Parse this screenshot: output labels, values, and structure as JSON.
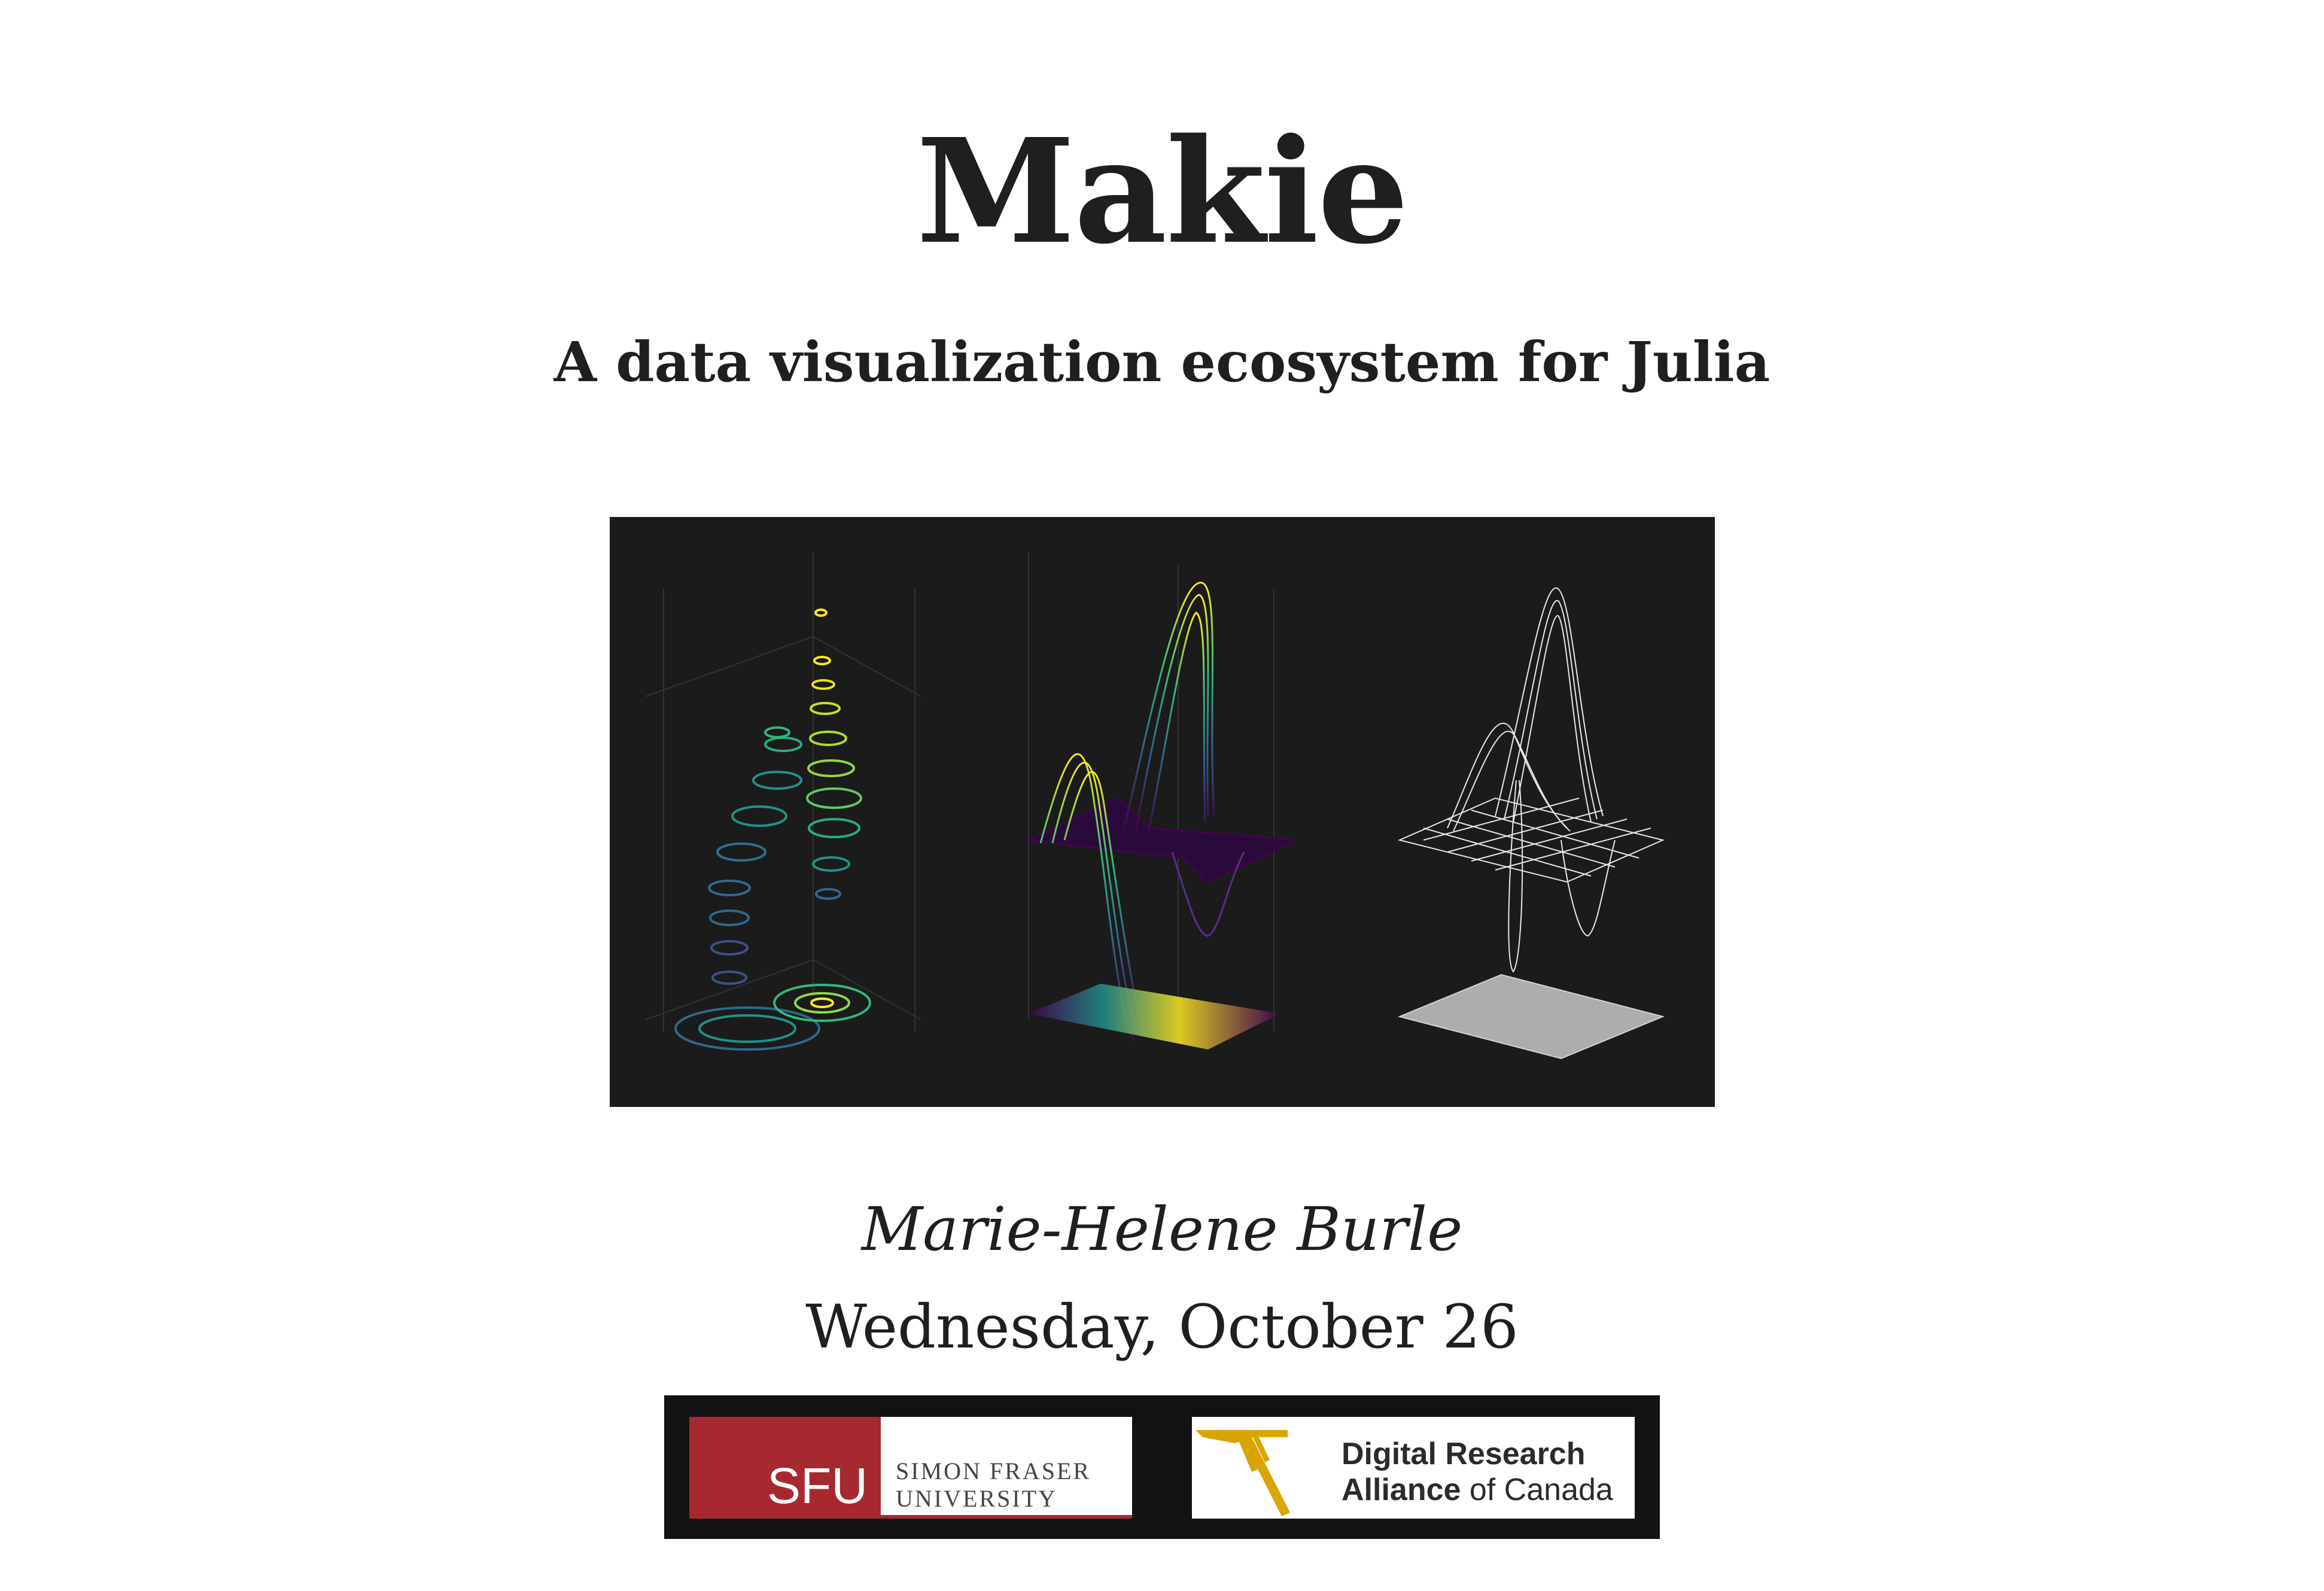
{
  "slide": {
    "title": "Makie",
    "subtitle": "A data visualization ecosystem for Julia",
    "author": "Marie-Helene Burle",
    "date": "Wednesday, October 26"
  },
  "logos": {
    "sfu": {
      "abbr": "SFU",
      "name_line1": "SIMON FRASER",
      "name_line2": "UNIVERSITY",
      "brand_color": "#a6292f"
    },
    "alliance": {
      "line1": "Digital Research",
      "line2_bold": "Alliance",
      "line2_rest": " of Canada",
      "brand_color": "#d9a500"
    }
  },
  "figure": {
    "background": "#1b1b1b",
    "panels": [
      "contour3d",
      "surface-lines",
      "wireframe"
    ]
  }
}
